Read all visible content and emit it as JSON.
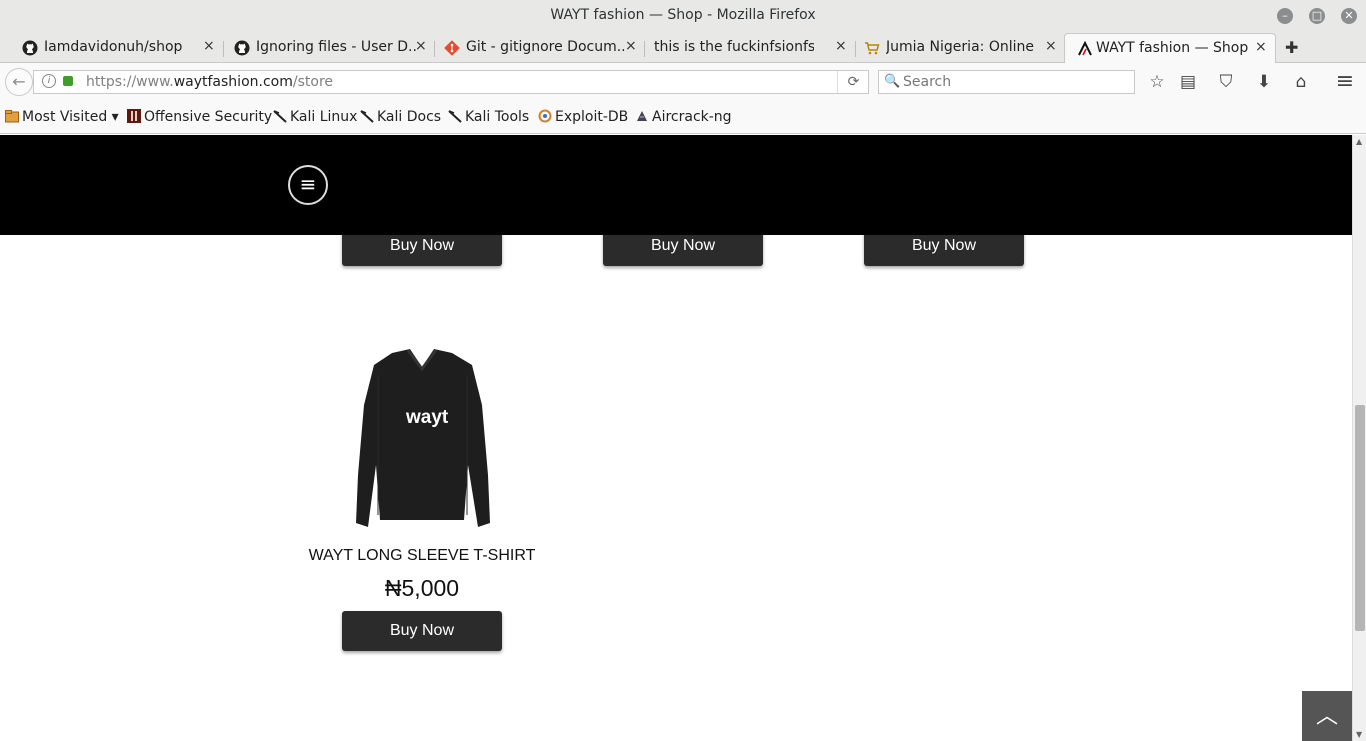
{
  "window": {
    "title": "WAYT fashion — Shop - Mozilla Firefox",
    "min_glyph": "–",
    "max_glyph": "□",
    "close_glyph": "✕"
  },
  "tabs": [
    {
      "label": "Iamdavidonuh/shop",
      "icon": "github-icon"
    },
    {
      "label": "Ignoring files - User D...",
      "icon": "github-icon"
    },
    {
      "label": "Git - gitignore Docum...",
      "icon": "git-icon"
    },
    {
      "label": "this is the fuckinfsionfs",
      "icon": "none"
    },
    {
      "label": "Jumia Nigeria: Online ...",
      "icon": "cart-icon"
    },
    {
      "label": "WAYT fashion — Shop",
      "icon": "wayt-icon",
      "active": true
    }
  ],
  "tab_close_glyph": "×",
  "new_tab_glyph": "✚",
  "nav": {
    "back_glyph": "←",
    "url_prefix": "https://www.",
    "url_host": "waytfashion.com",
    "url_path": "/store",
    "reload_glyph": "⟳",
    "search_placeholder": "Search",
    "search_glyph": "🔍",
    "toolbar_glyphs": {
      "bookmark_star": "☆",
      "reading_list": "▤",
      "pocket": "⛉",
      "download": "⬇",
      "home": "⌂",
      "menu": "≡"
    }
  },
  "bookmarks": [
    {
      "label": "Most Visited ▾",
      "icon": "folder-icon"
    },
    {
      "label": "Offensive Security",
      "icon": "offsec-icon"
    },
    {
      "label": "Kali Linux",
      "icon": "kali-icon"
    },
    {
      "label": "Kali Docs",
      "icon": "kali-icon"
    },
    {
      "label": "Kali Tools",
      "icon": "kali-icon"
    },
    {
      "label": "Exploit-DB",
      "icon": "exploitdb-icon"
    },
    {
      "label": "Aircrack-ng",
      "icon": "aircrack-icon"
    }
  ],
  "site": {
    "menu_glyph": "≡",
    "buy_label": "Buy Now",
    "product": {
      "name": "WAYT LONG SLEEVE T-SHIRT",
      "price": "₦5,000",
      "logo_text": "wayt"
    },
    "back_to_top_glyph": "︿"
  },
  "scrollbar": {
    "up_glyph": "▲",
    "down_glyph": "▼"
  },
  "colors": {
    "header_bg": "#000000",
    "button_bg": "#2b2b2b",
    "lock_green": "#3f9d2a"
  }
}
